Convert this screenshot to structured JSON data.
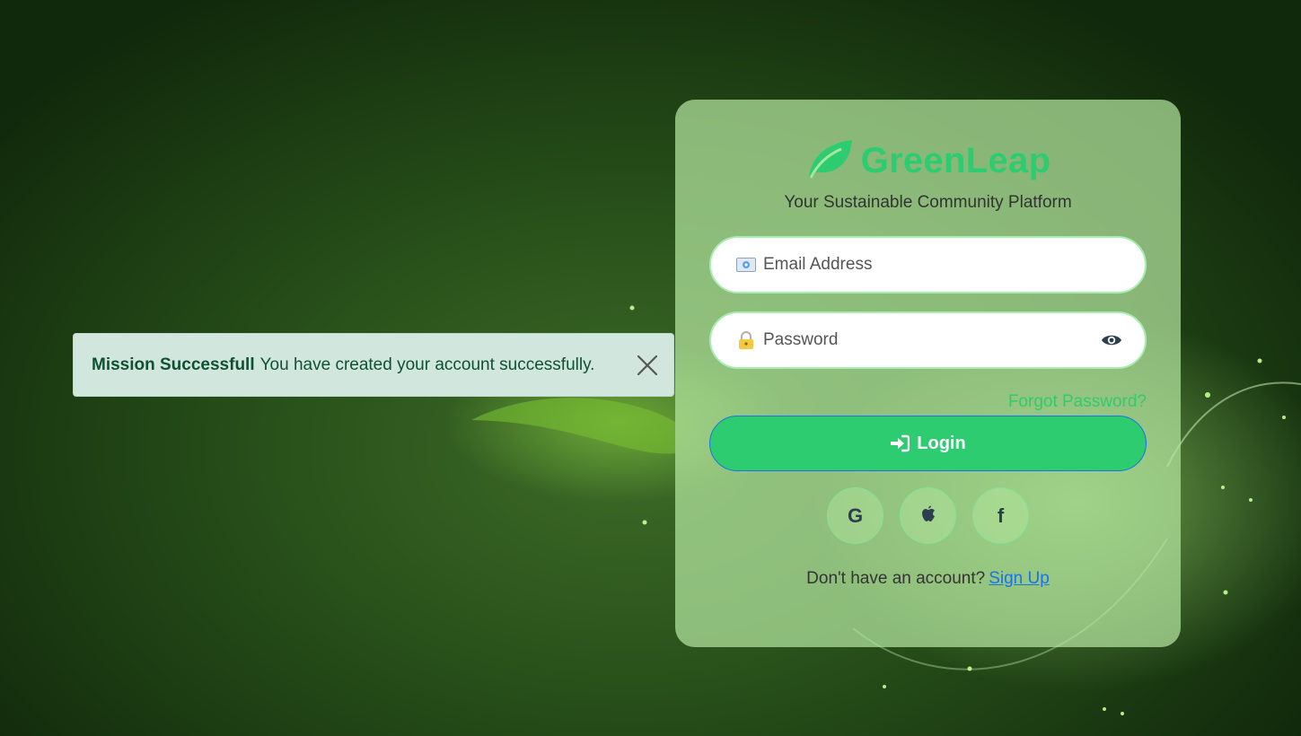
{
  "toast": {
    "title": "Mission Successfull",
    "message": "You have created your account successfully."
  },
  "brand": {
    "name": "GreenLeap",
    "tagline": "Your Sustainable Community Platform",
    "color": "#2ecc71"
  },
  "form": {
    "email_placeholder": "Email Address",
    "password_placeholder": "Password",
    "forgot_label": "Forgot Password?",
    "login_label": "Login"
  },
  "social": {
    "google_label": "G",
    "apple_label": "apple-icon",
    "facebook_label": "f"
  },
  "signup": {
    "prompt": "Don't have an account?",
    "link_label": "Sign Up"
  },
  "colors": {
    "accent": "#2ecc71",
    "link": "#1a73e8",
    "toast_bg": "#d1e7dd",
    "toast_text": "#0f5132"
  }
}
